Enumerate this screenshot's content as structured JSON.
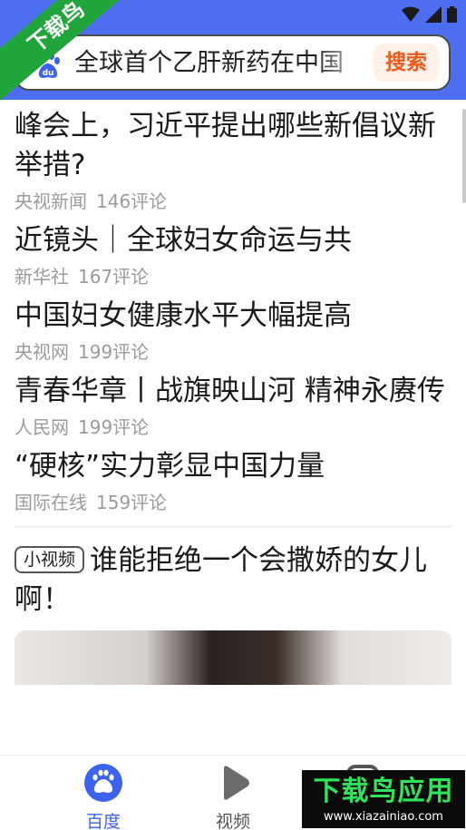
{
  "search": {
    "query": "全球首个乙肝新药在中国",
    "button_label": "搜索"
  },
  "watermark": {
    "ribbon": "下载鸟",
    "name": "下载鸟应用",
    "url": "www.xiazainiao.com"
  },
  "news": [
    {
      "title": "峰会上，习近平提出哪些新倡议新举措?",
      "source": "央视新闻",
      "comments": "146评论"
    },
    {
      "title": "近镜头｜全球妇女命运与共",
      "source": "新华社",
      "comments": "167评论"
    },
    {
      "title": "中国妇女健康水平大幅提高",
      "source": "央视网",
      "comments": "199评论"
    },
    {
      "title": "青春华章丨战旗映山河 精神永赓传",
      "source": "人民网",
      "comments": "199评论"
    },
    {
      "title": "“硬核”实力彰显中国力量",
      "source": "国际在线",
      "comments": "159评论"
    }
  ],
  "video_card": {
    "tag": "小视频",
    "title": "谁能拒绝一个会撒娇的女儿啊！"
  },
  "bottom_nav": {
    "home_label": "百度",
    "video_label": "视频"
  },
  "colors": {
    "header": "#4e6ef2",
    "search_button_text": "#f05a1f",
    "nav_active": "#3b62f0"
  }
}
